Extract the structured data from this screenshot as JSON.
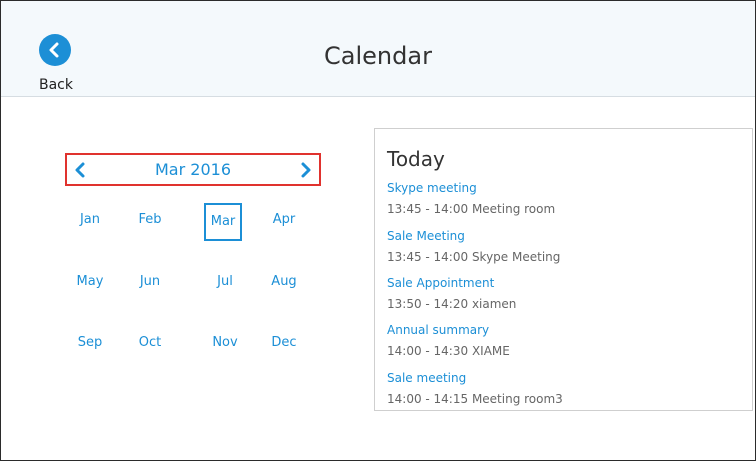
{
  "header": {
    "title": "Calendar",
    "back_label": "Back"
  },
  "year_picker": {
    "current_label": "Mar 2016",
    "months": [
      "Jan",
      "Feb",
      "Mar",
      "Apr",
      "May",
      "Jun",
      "Jul",
      "Aug",
      "Sep",
      "Oct",
      "Nov",
      "Dec"
    ],
    "selected_month": "Mar"
  },
  "today_panel": {
    "title": "Today",
    "events": [
      {
        "title": "Skype meeting",
        "meta": "13:45 - 14:00 Meeting room"
      },
      {
        "title": "Sale Meeting",
        "meta": "13:45 - 14:00 Skype Meeting"
      },
      {
        "title": "Sale Appointment",
        "meta": "13:50 - 14:20 xiamen"
      },
      {
        "title": "Annual summary",
        "meta": "14:00 - 14:30 XIAME"
      },
      {
        "title": "Sale meeting",
        "meta": "14:00 - 14:15 Meeting room3"
      }
    ]
  },
  "colors": {
    "accent": "#1c8fd6",
    "highlight_border": "#e0322e",
    "header_bg": "#f4f9fc"
  }
}
